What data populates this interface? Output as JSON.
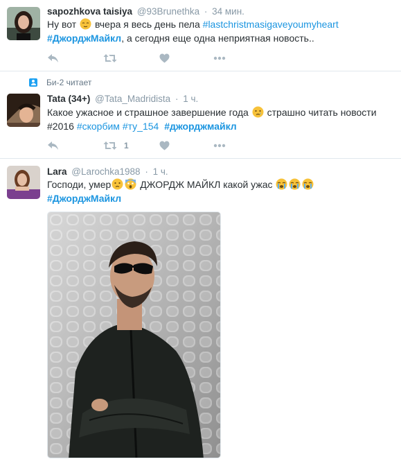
{
  "tweets": [
    {
      "name": "sapozhkova taisiya",
      "handle": "@93Brunethka",
      "dot": "·",
      "time": "34 мин.",
      "line1_pre": "Ну вот",
      "line1_post": "вчера я весь день пела",
      "line1_tag": "#lastchristmasigaveyoumyheart",
      "line2_tag": "#ДжорджМайкл",
      "line2_text": ", а сегодня еще одна неприятная новость..",
      "retweet_count": ""
    },
    {
      "context": "Би-2 читает",
      "name": "Tata (34+)",
      "handle": "@Tata_Madridista",
      "dot": "·",
      "time": "1 ч.",
      "line1": "Какое ужасное и страшное завершение года",
      "line1_post": "страшно читать новости",
      "line2_plain": "#2016",
      "line2_tag1": "#скорбим",
      "line2_tag2": "#ту_154",
      "line2_tag3": "#джорджмайкл",
      "retweet_count": "1"
    },
    {
      "name": "Lara",
      "handle": "@Larochka1988",
      "dot": "·",
      "time": "1 ч.",
      "line1_pre": "Господи, умер",
      "line1_mid": "ДЖОРДЖ МАЙКЛ какой ужас",
      "line2_tag": "#ДжорджМайкл"
    }
  ],
  "icons": [
    "reply-icon",
    "retweet-icon",
    "like-icon",
    "more-icon",
    "follow-context-icon"
  ],
  "colors": {
    "link": "#1b95e0",
    "muted": "#8899a6",
    "text": "#292f33",
    "divider": "#e1e8ed",
    "accent": "#1da1f2"
  }
}
